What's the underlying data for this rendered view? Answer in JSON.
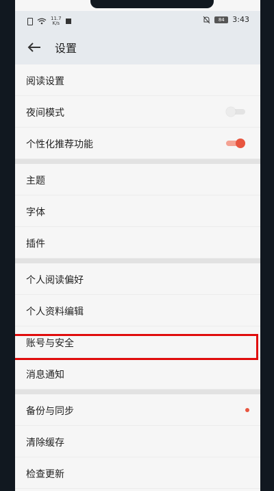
{
  "status_bar": {
    "net_speed_value": "11.7",
    "net_speed_unit": "K/s",
    "battery": "84",
    "time": "3:43"
  },
  "header": {
    "title": "设置"
  },
  "groups": [
    {
      "items": [
        {
          "label": "阅读设置"
        },
        {
          "label": "夜间模式",
          "toggle": "off"
        },
        {
          "label": "个性化推荐功能",
          "toggle": "on"
        }
      ]
    },
    {
      "items": [
        {
          "label": "主题"
        },
        {
          "label": "字体"
        },
        {
          "label": "插件"
        }
      ]
    },
    {
      "items": [
        {
          "label": "个人阅读偏好"
        },
        {
          "label": "个人资料编辑"
        },
        {
          "label": "账号与安全",
          "highlighted": true
        },
        {
          "label": "消息通知"
        }
      ]
    },
    {
      "items": [
        {
          "label": "备份与同步",
          "badge": "red-dot"
        },
        {
          "label": "清除缓存"
        },
        {
          "label": "检查更新"
        }
      ]
    }
  ],
  "colors": {
    "accent": "#e8553f",
    "highlight_border": "#e00b0b"
  }
}
